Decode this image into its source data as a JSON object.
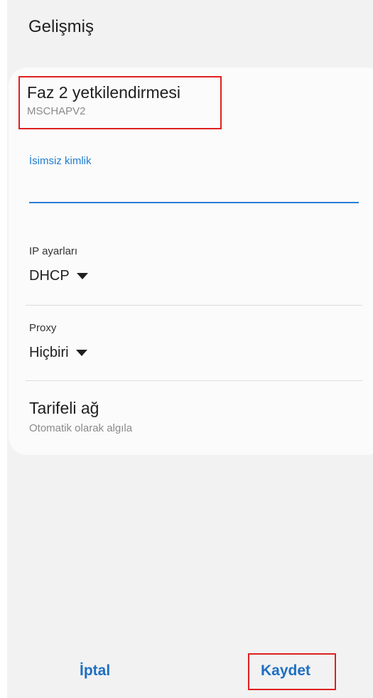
{
  "header": {
    "title": "Gelişmiş"
  },
  "phase2": {
    "title": "Faz 2 yetkilendirmesi",
    "value": "MSCHAPV2"
  },
  "anonymous_identity": {
    "label": "İsimsiz kimlik",
    "value": ""
  },
  "ip_settings": {
    "label": "IP ayarları",
    "value": "DHCP"
  },
  "proxy": {
    "label": "Proxy",
    "value": "Hiçbiri"
  },
  "metered": {
    "title": "Tarifeli ağ",
    "value": "Otomatik olarak algıla"
  },
  "buttons": {
    "cancel": "İptal",
    "save": "Kaydet"
  },
  "colors": {
    "accent": "#1f6fc2",
    "highlight": "#e02020",
    "background": "#f2f2f2",
    "card": "#fbfbfb"
  }
}
